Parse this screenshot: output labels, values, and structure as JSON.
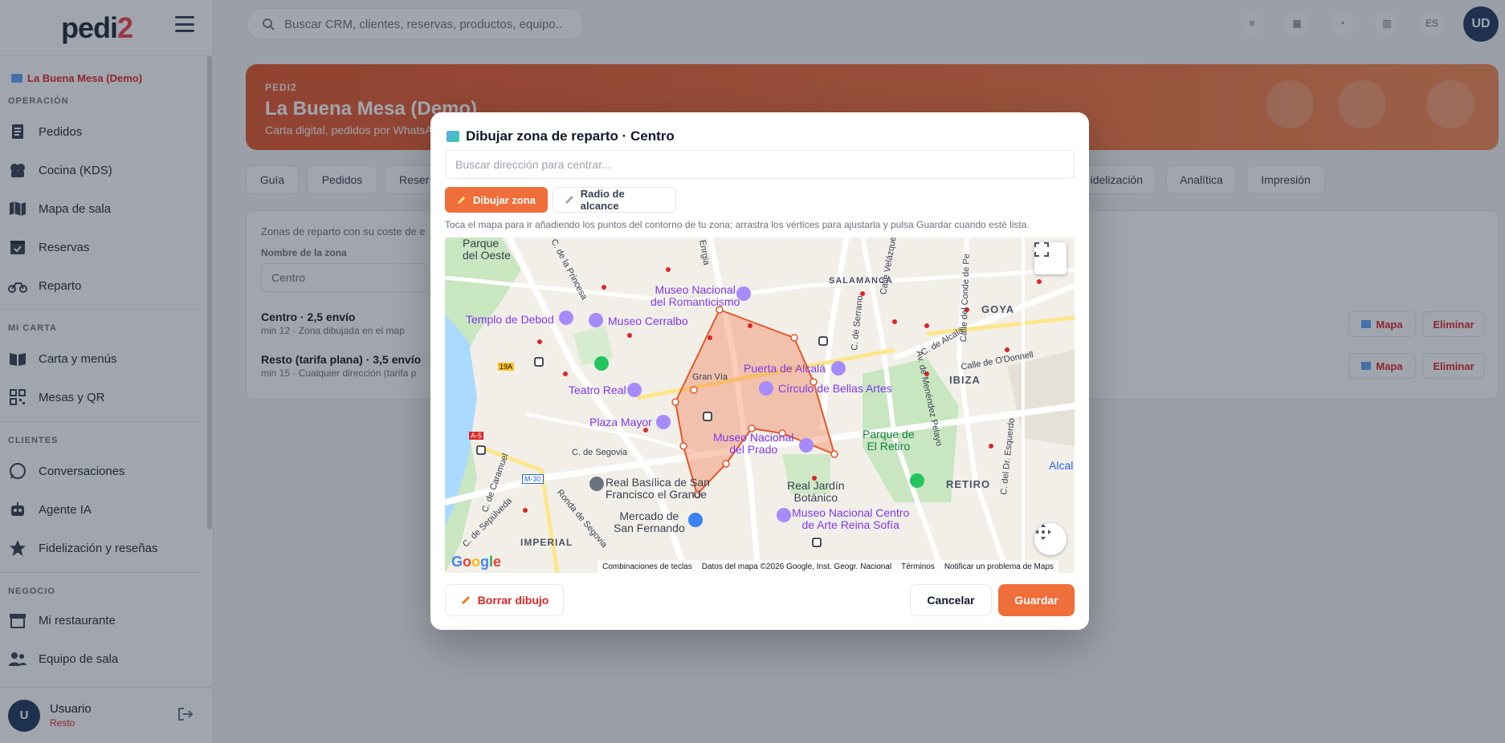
{
  "app": {
    "logo_main": "pedi",
    "logo_accent": "2",
    "accent_color": "#f06e3a",
    "danger_color": "#dc2626"
  },
  "sidebar": {
    "restaurant": "La Buena Mesa (Demo)",
    "sections": {
      "operacion": "OPERACIÓN",
      "mi_carta": "MI CARTA",
      "clientes": "CLIENTES",
      "negocio": "NEGOCIO"
    },
    "items": {
      "pedidos": "Pedidos",
      "cocina": "Cocina (KDS)",
      "mapa_sala": "Mapa de sala",
      "reservas": "Reservas",
      "reparto": "Reparto",
      "carta": "Carta y menús",
      "mesas": "Mesas y QR",
      "conversaciones": "Conversaciones",
      "agente": "Agente IA",
      "fidelizacion": "Fidelización y reseñas",
      "restaurante": "Mi restaurante",
      "equipo": "Equipo de sala"
    },
    "user": {
      "initial": "U",
      "name": "Usuario",
      "role": "Resto"
    }
  },
  "topbar": {
    "search_placeholder": "Buscar CRM, clientes, reservas, productos, equipo..",
    "lang": "ES",
    "avatar": "UD"
  },
  "banner": {
    "kicker": "PEDI2",
    "title": "La Buena Mesa (Demo)",
    "subtitle": "Carta digital, pedidos por WhatsA"
  },
  "tabs": {
    "guia": "Guía",
    "pedidos": "Pedidos",
    "reservas": "Reser",
    "fidelizacion": "idelización",
    "analitica": "Analítica",
    "impresion": "Impresión"
  },
  "content": {
    "intro": "Zonas de reparto con su coste de e",
    "name_label": "Nombre de la zona",
    "name_value": "Centro",
    "zones": [
      {
        "title": "Centro · 2,5 envío",
        "meta": "min 12 · ",
        "meta_detail": "Zona dibujada en el map"
      },
      {
        "title": "Resto (tarifa plana) · 3,5 envío",
        "meta": "min 15 · Cualquier dirección (tarifa p"
      }
    ],
    "map_button": "Mapa",
    "delete_button": "Eliminar"
  },
  "modal": {
    "title": "Dibujar zona de reparto · Centro",
    "search_placeholder": "Buscar dirección para centrar...",
    "draw_button": "Dibujar zona",
    "radius_button": "Radio de alcance",
    "hint": "Toca el mapa para ir añadiendo los puntos del contorno de tu zona; arrastra los vértices para ajustarla y pulsa Guardar cuando esté lista.",
    "clear_button": "Borrar dibujo",
    "cancel_button": "Cancelar",
    "save_button": "Guardar"
  },
  "map": {
    "labels": {
      "parque_oeste": "Parque\ndel Oeste",
      "princesa": "C. de la Princesa",
      "museo_romanticismo": "Museo Nacional\ndel Romanticismo",
      "templo_debod": "Templo de Debod",
      "museo_cerralbo": "Museo Cerralbo",
      "salamanca": "SALAMANCA",
      "goya": "GOYA",
      "puerta_alcala": "Puerta de Alcalá",
      "circulo_bellas_artes": "Círculo de Bellas Artes",
      "gran_via": "Gran Vía",
      "teatro_real": "Teatro Real",
      "plaza_mayor": "Plaza Mayor",
      "museo_prado": "Museo Nacional\ndel Prado",
      "parque_retiro": "Parque de\nEl Retiro",
      "ibiza": "IBIZA",
      "retiro": "RETIRO",
      "c_segovia": "C. de Segovia",
      "basilica": "Real Basílica de San\nFrancisco el Grande",
      "jardin_botanico": "Real Jardín\nBotánico",
      "mercado": "Mercado de\nSan Fernando",
      "reina_sofia": "Museo Nacional Centro\nde Arte Reina Sofía",
      "imperial": "IMPERIAL",
      "alcala": "Alcal",
      "donnell": "Calle de O'Donnell",
      "velazquez": "Calle Velázquez",
      "serrano": "C. de Serrano",
      "menendez_pelayo": "Av. de Menéndez Pelayo",
      "esquerdo": "C. del Dr. Esquerdo",
      "conde_penalver": "Calle del Conde de Pe",
      "sepulveda": "C. de Sepúlveda",
      "ronda_segovia": "Ronda de Segovia",
      "caramuel": "C. de Caramuel",
      "calle_alcala": "C. de Alcalá",
      "m30": "M-30",
      "a5": "A-5",
      "r19a": "19A",
      "enrga": "Enrgia"
    },
    "google": [
      "G",
      "o",
      "o",
      "g",
      "l",
      "e"
    ],
    "attribution": {
      "shortcuts": "Combinaciones de teclas",
      "data": "Datos del mapa ©2026 Google, Inst. Geogr. Nacional",
      "terms": "Términos",
      "report": "Notificar un problema de Maps"
    }
  }
}
